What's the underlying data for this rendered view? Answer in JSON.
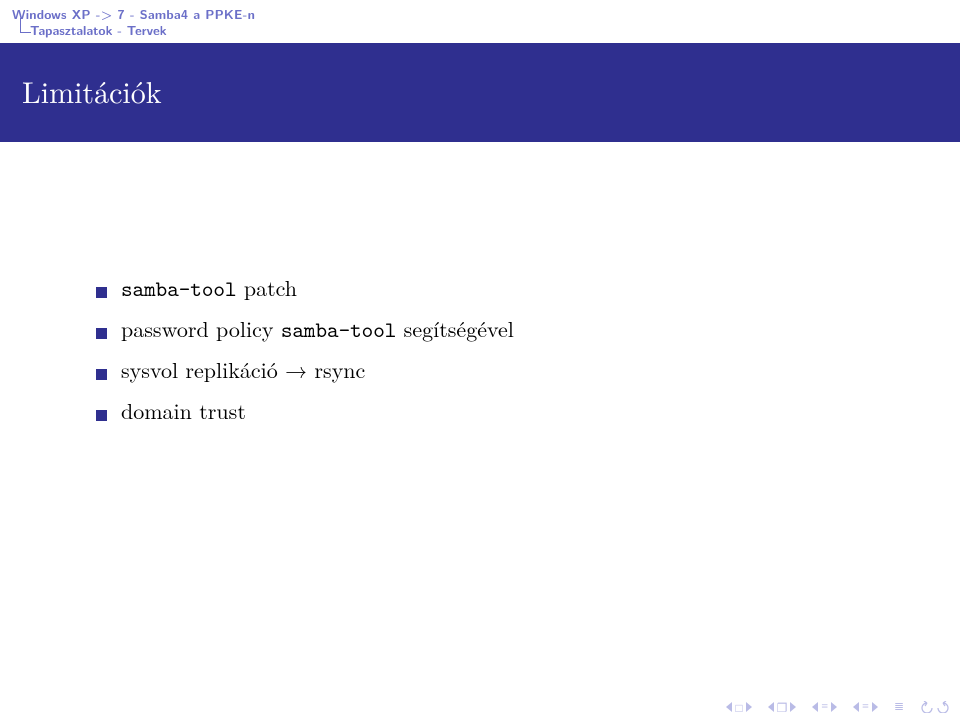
{
  "crumbs": {
    "line1": "Windows XP -> 7 - Samba4 a PPKE-n",
    "line2": "Tapasztalatok - Tervek"
  },
  "title": "Limitációk",
  "items": [
    {
      "mono1": "samba-tool",
      "rest1": " patch"
    },
    {
      "plain0": "password policy ",
      "mono1": "samba-tool",
      "rest1": " segítségével"
    },
    {
      "plain0": "sysvol replikáció → rsync"
    },
    {
      "plain0": "domain trust"
    }
  ],
  "nav": {
    "boxGlyph": "□",
    "docGlyph": "❐",
    "eqGlyph": "≡",
    "eqGlyph2": "≡"
  }
}
